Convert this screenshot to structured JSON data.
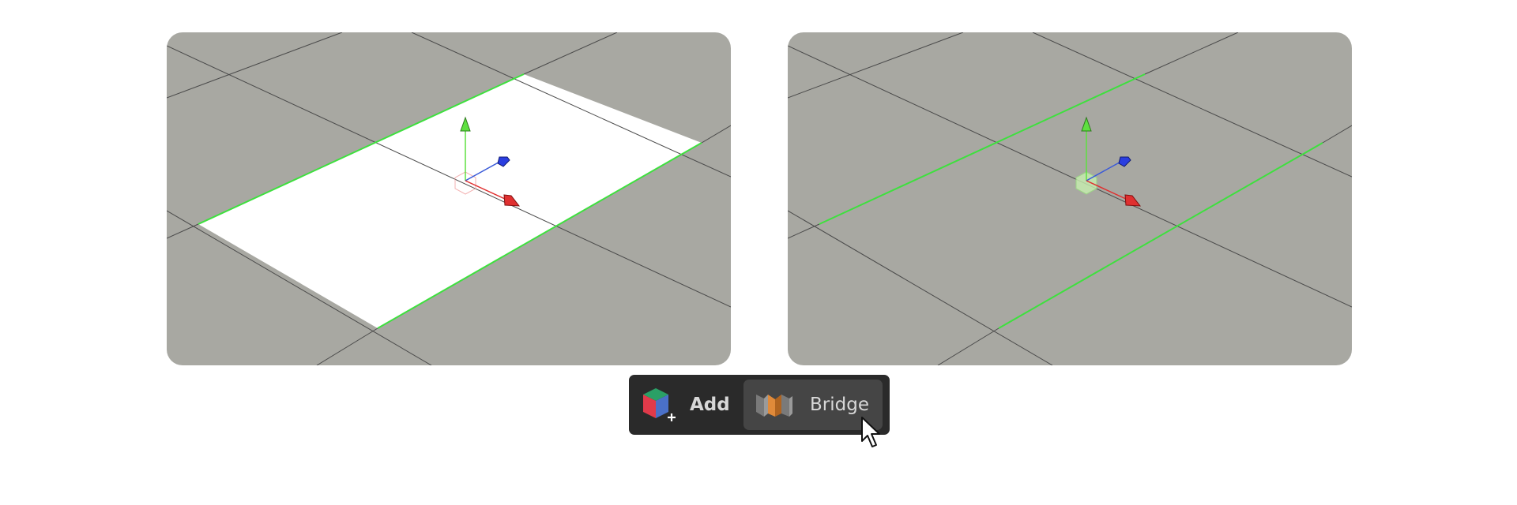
{
  "toolbar": {
    "add_label": "Add",
    "bridge_label": "Bridge"
  },
  "icons": {
    "add": "add-cube-icon",
    "bridge": "bridge-icon",
    "cursor": "mouse-pointer-icon",
    "gizmo": "transform-gizmo-icon"
  },
  "colors": {
    "viewport_bg": "#a8a8a2",
    "grid_line": "#4a4a4a",
    "selected_edge": "#3ee03e",
    "selected_face": "#ffffff",
    "axis_x": "#e03030",
    "axis_y": "#5ee040",
    "axis_z": "#2a3ee0",
    "toolbar_bg": "#2a2a2a",
    "button_bg": "#454545"
  }
}
